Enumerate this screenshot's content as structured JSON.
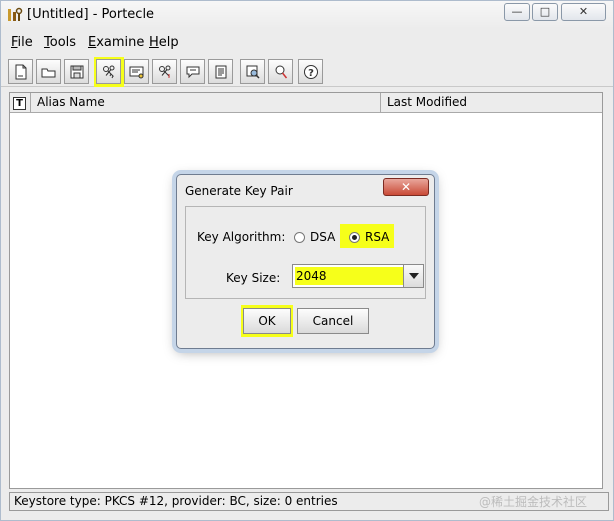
{
  "window": {
    "title": "[Untitled] - Portecle",
    "minimize_glyph": "—",
    "maximize_glyph": "□",
    "close_glyph": "✕"
  },
  "menu": [
    {
      "first": "F",
      "rest": "ile"
    },
    {
      "first": "T",
      "rest": "ools"
    },
    {
      "first": "E",
      "rest": "xamine"
    },
    {
      "first": "H",
      "rest": "elp"
    }
  ],
  "toolbar": {
    "buttons": [
      {
        "icon": "new-keystore-icon"
      },
      {
        "icon": "open-keystore-icon"
      },
      {
        "icon": "save-keystore-icon"
      },
      {
        "icon": "generate-key-pair-icon",
        "highlighted": true
      },
      {
        "icon": "import-trusted-cert-icon"
      },
      {
        "icon": "import-key-pair-icon"
      },
      {
        "icon": "set-keystore-password-icon"
      },
      {
        "icon": "keystore-report-icon"
      },
      {
        "icon": "examine-cert-icon"
      },
      {
        "icon": "examine-ssl-icon"
      },
      {
        "icon": "help-icon"
      }
    ],
    "highlight_color": "#f6ff1a"
  },
  "table": {
    "type_header": "T",
    "columns": [
      "Alias Name",
      "Last Modified"
    ]
  },
  "status": {
    "text": "Keystore type: PKCS #12, provider: BC, size: 0 entries"
  },
  "watermark": "@稀土掘金技术社区",
  "dialog": {
    "title": "Generate Key Pair",
    "close_glyph": "✕",
    "key_algorithm_label": "Key Algorithm:",
    "algorithms": [
      {
        "label": "DSA",
        "selected": false
      },
      {
        "label": "RSA",
        "selected": true
      }
    ],
    "key_size_label": "Key Size:",
    "key_size_value": "2048",
    "ok_label": "OK",
    "cancel_label": "Cancel"
  }
}
